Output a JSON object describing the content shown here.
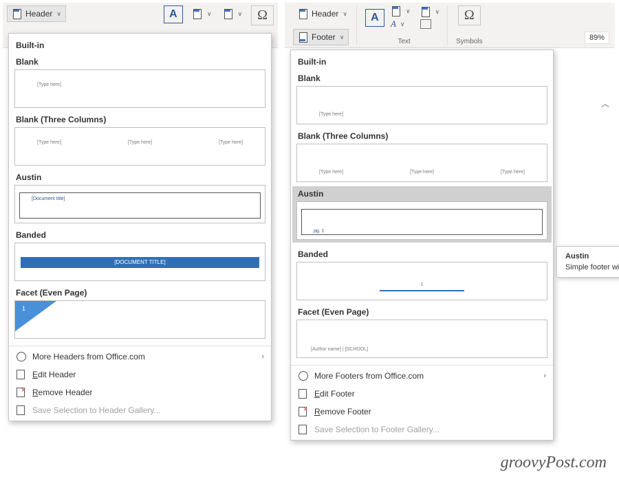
{
  "left": {
    "ribbon": {
      "header_btn": "Header"
    },
    "gallery": {
      "section": "Built-in",
      "items": [
        {
          "name": "Blank",
          "ph1": "[Type here]"
        },
        {
          "name": "Blank (Three Columns)",
          "ph1": "[Type here]",
          "ph2": "[Type here]",
          "ph3": "[Type here]"
        },
        {
          "name": "Austin",
          "ph1": "[Document title]"
        },
        {
          "name": "Banded",
          "ph1": "[DOCUMENT TITLE]"
        },
        {
          "name": "Facet (Even Page)",
          "pg": "1"
        }
      ],
      "footer_menu": {
        "more": "More Headers from Office.com",
        "edit": "Edit Header",
        "remove": "Remove Header",
        "save": "Save Selection to Header Gallery..."
      }
    }
  },
  "right": {
    "ribbon": {
      "header_btn": "Header",
      "footer_btn": "Footer",
      "text_group": "Text",
      "symbols_group": "Symbols"
    },
    "gallery": {
      "section": "Built-in",
      "items": [
        {
          "name": "Blank",
          "ph1": "[Type here]"
        },
        {
          "name": "Blank (Three Columns)",
          "ph1": "[Type here]",
          "ph2": "[Type here]",
          "ph3": "[Type here]"
        },
        {
          "name": "Austin",
          "pg": "pg. 1"
        },
        {
          "name": "Banded",
          "pg": "1"
        },
        {
          "name": "Facet (Even Page)",
          "ph1": "[Author name] | [SCHOOL]"
        }
      ],
      "footer_menu": {
        "more": "More Footers from Office.com",
        "edit": "Edit Footer",
        "remove": "Remove Footer",
        "save": "Save Selection to Footer Gallery..."
      }
    },
    "tooltip": {
      "title": "Austin",
      "desc": "Simple footer with a page border"
    },
    "zoom": "89%"
  },
  "watermark": "groovyPost.com"
}
